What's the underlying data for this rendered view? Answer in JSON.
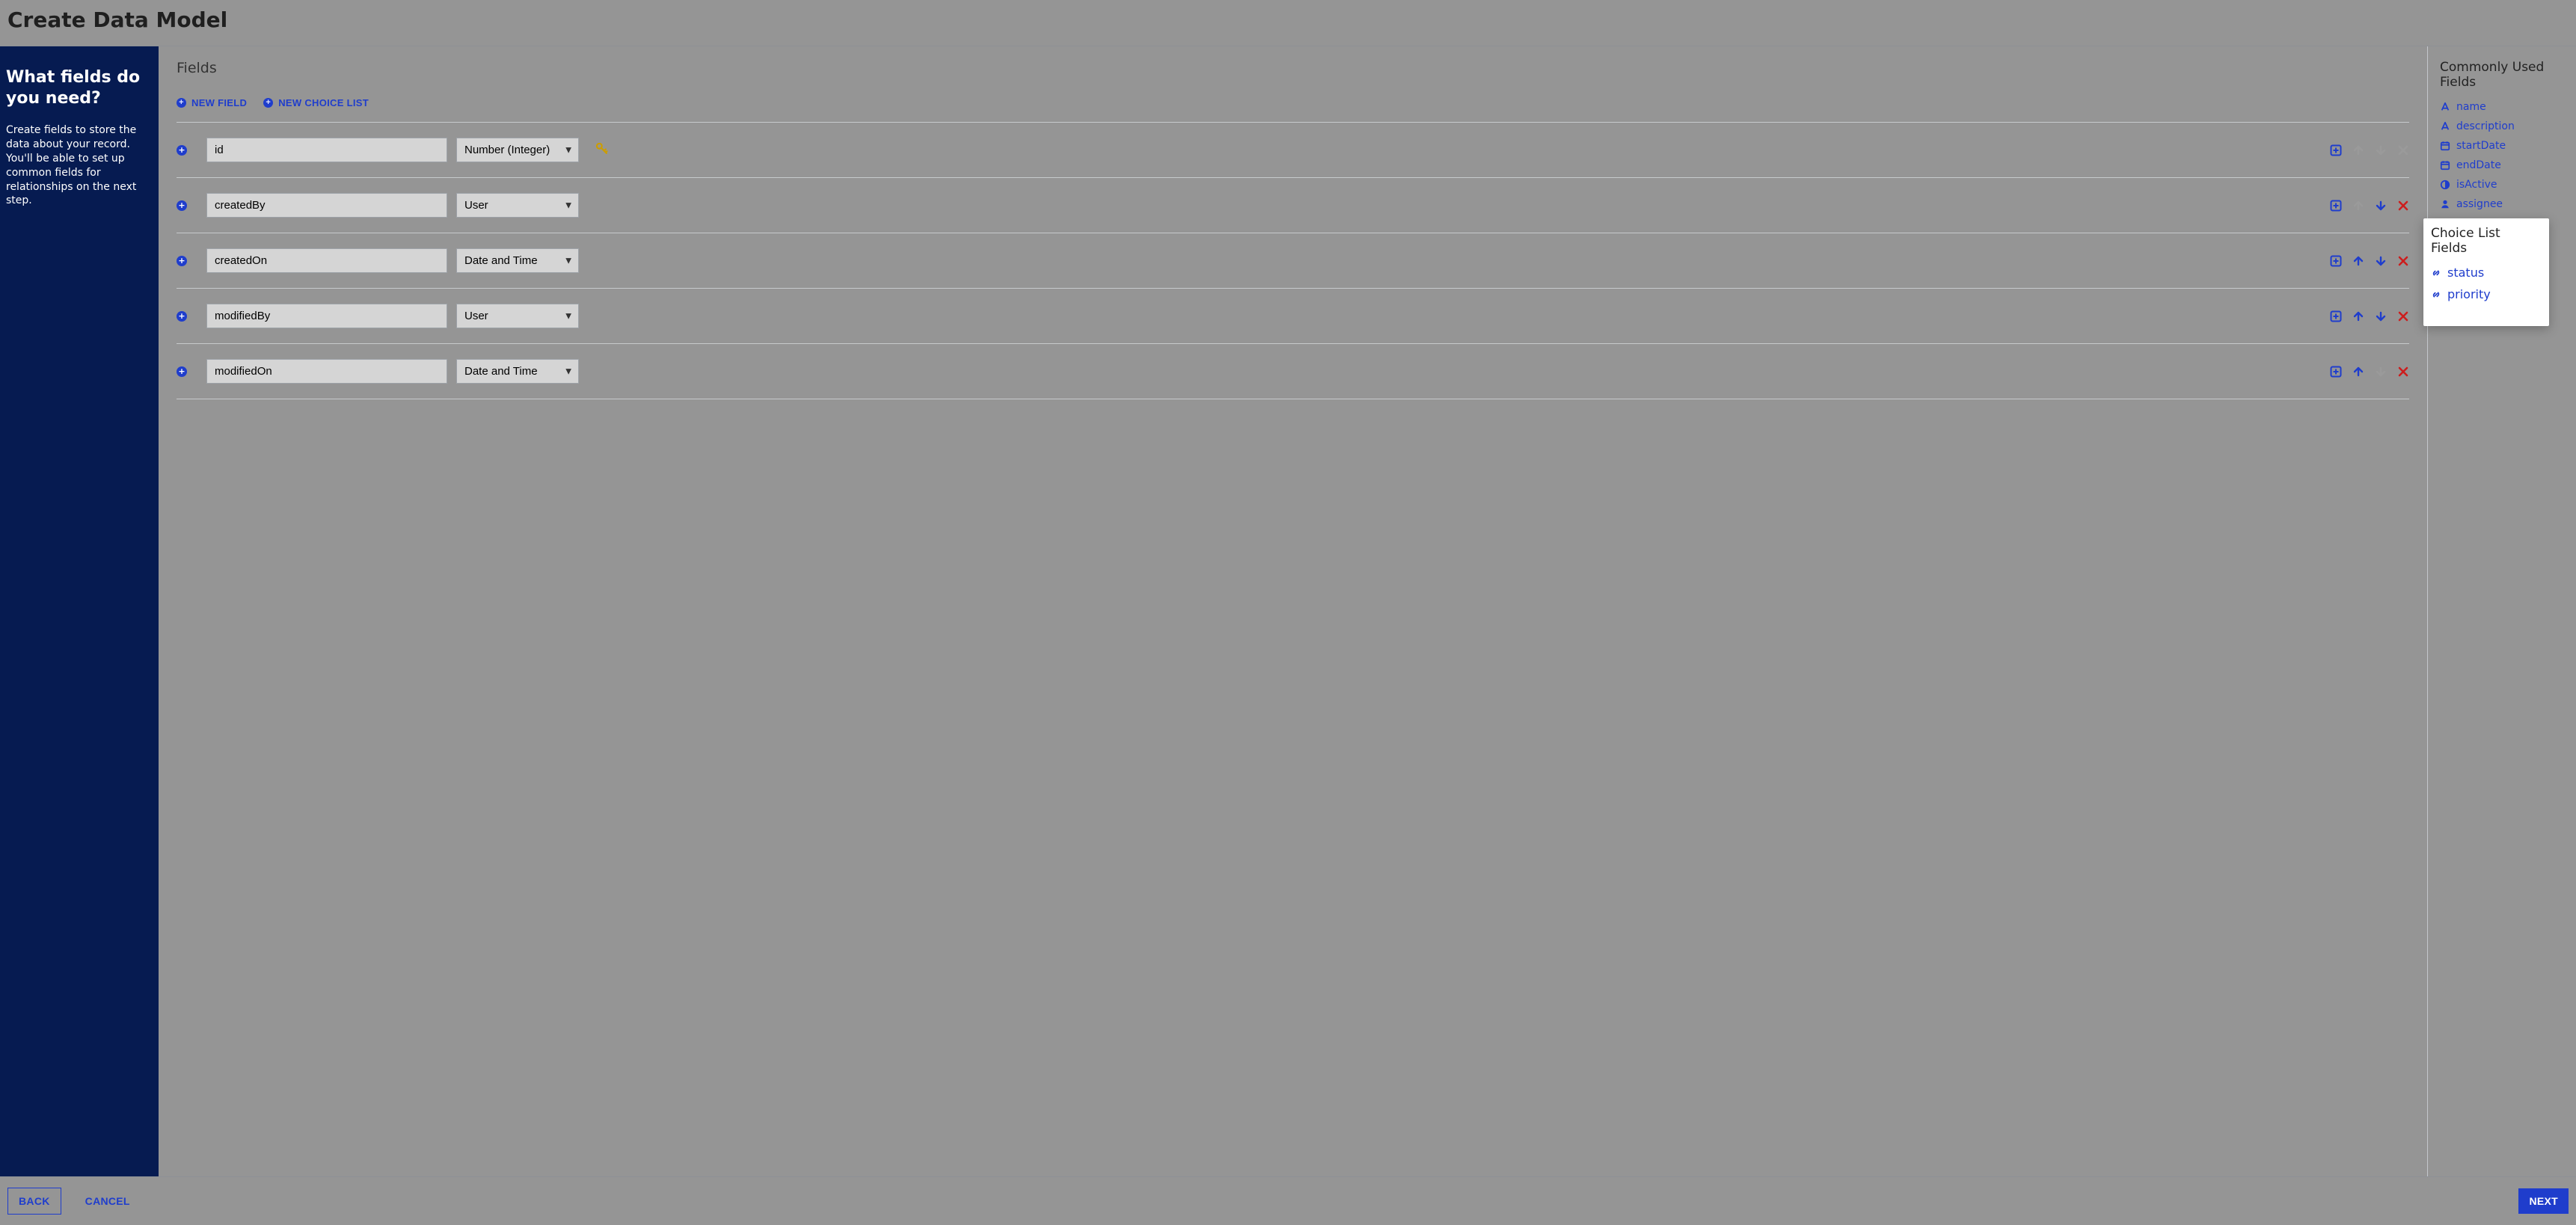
{
  "dialog": {
    "title": "Create Data Model"
  },
  "sidebar": {
    "heading": "What fields do you need?",
    "body": "Create fields to store the data about your record. You'll be able to set up common fields for relationships on the next step."
  },
  "main": {
    "section_title": "Fields",
    "new_field_label": "NEW FIELD",
    "new_choice_list_label": "NEW CHOICE LIST",
    "type_options": [
      "Number (Integer)",
      "User",
      "Date and Time"
    ],
    "fields": [
      {
        "name": "id",
        "type": "Number (Integer)",
        "is_key": true,
        "up": false,
        "down": false,
        "del": false
      },
      {
        "name": "createdBy",
        "type": "User",
        "is_key": false,
        "up": false,
        "down": true,
        "del": true
      },
      {
        "name": "createdOn",
        "type": "Date and Time",
        "is_key": false,
        "up": true,
        "down": true,
        "del": true
      },
      {
        "name": "modifiedBy",
        "type": "User",
        "is_key": false,
        "up": true,
        "down": true,
        "del": true
      },
      {
        "name": "modifiedOn",
        "type": "Date and Time",
        "is_key": false,
        "up": true,
        "down": false,
        "del": true
      }
    ]
  },
  "rightpanel": {
    "common_title": "Commonly Used Fields",
    "common": [
      {
        "icon": "font",
        "label": "name"
      },
      {
        "icon": "font",
        "label": "description"
      },
      {
        "icon": "calendar",
        "label": "startDate"
      },
      {
        "icon": "calendar",
        "label": "endDate"
      },
      {
        "icon": "contrast",
        "label": "isActive"
      },
      {
        "icon": "user",
        "label": "assignee"
      }
    ],
    "choice_title": "Choice List Fields",
    "choice": [
      {
        "icon": "link",
        "label": "status"
      },
      {
        "icon": "link",
        "label": "priority"
      }
    ]
  },
  "footer": {
    "back": "BACK",
    "cancel": "CANCEL",
    "next": "NEXT"
  }
}
